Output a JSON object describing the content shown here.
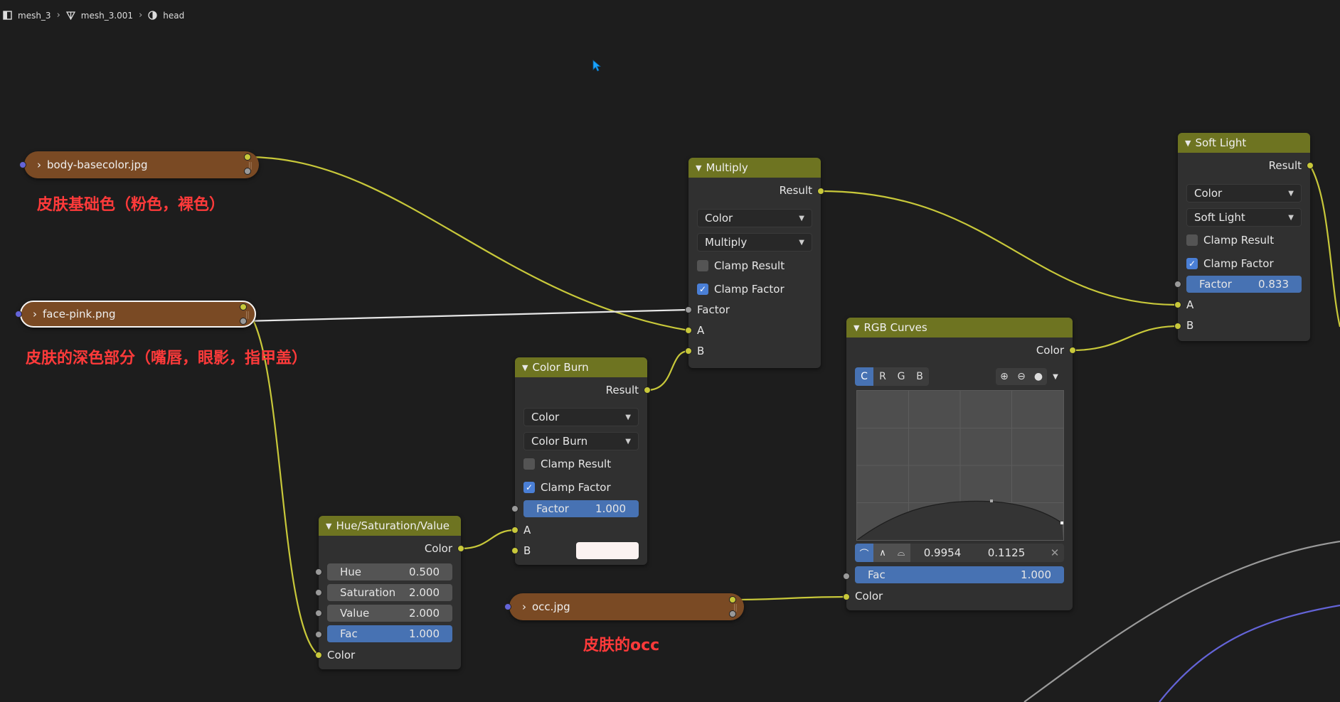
{
  "breadcrumb": {
    "object": "mesh_3",
    "mesh": "mesh_3.001",
    "material": "head"
  },
  "image_nodes": {
    "body": "body-basecolor.jpg",
    "face": "face-pink.png",
    "occ": "occ.jpg"
  },
  "annotations": {
    "body": "皮肤基础色（粉色，裸色）",
    "face": "皮肤的深色部分（嘴唇，眼影，指甲盖）",
    "occ": "皮肤的occ"
  },
  "multiply": {
    "title": "Multiply",
    "result": "Result",
    "data_type": "Color",
    "blend": "Multiply",
    "clamp_result": "Clamp Result",
    "clamp_factor": "Clamp Factor",
    "factor": "Factor",
    "a": "A",
    "b": "B"
  },
  "soft_light": {
    "title": "Soft Light",
    "result": "Result",
    "data_type": "Color",
    "blend": "Soft Light",
    "clamp_result": "Clamp Result",
    "clamp_factor": "Clamp Factor",
    "factor_label": "Factor",
    "factor_value": "0.833",
    "a": "A",
    "b": "B"
  },
  "color_burn": {
    "title": "Color Burn",
    "result": "Result",
    "data_type": "Color",
    "blend": "Color Burn",
    "clamp_result": "Clamp Result",
    "clamp_factor": "Clamp Factor",
    "factor_label": "Factor",
    "factor_value": "1.000",
    "a": "A",
    "b": "B",
    "b_color": "#fbf2f1"
  },
  "hsv": {
    "title": "Hue/Saturation/Value",
    "color_out": "Color",
    "hue_label": "Hue",
    "hue_value": "0.500",
    "sat_label": "Saturation",
    "sat_value": "2.000",
    "val_label": "Value",
    "val_value": "2.000",
    "fac_label": "Fac",
    "fac_value": "1.000",
    "color_in": "Color"
  },
  "rgb_curves": {
    "title": "RGB Curves",
    "color_out": "Color",
    "channels": [
      "C",
      "R",
      "G",
      "B"
    ],
    "point_x": "0.9954",
    "point_y": "0.1125",
    "fac_label": "Fac",
    "fac_value": "1.000",
    "color_in": "Color"
  },
  "colors": {
    "mix_header": "#6e7421",
    "image_node": "#7a4a24",
    "wire_color": "#c8c83a",
    "annotation": "#ff3a3a",
    "active_blue": "#4772b3"
  }
}
